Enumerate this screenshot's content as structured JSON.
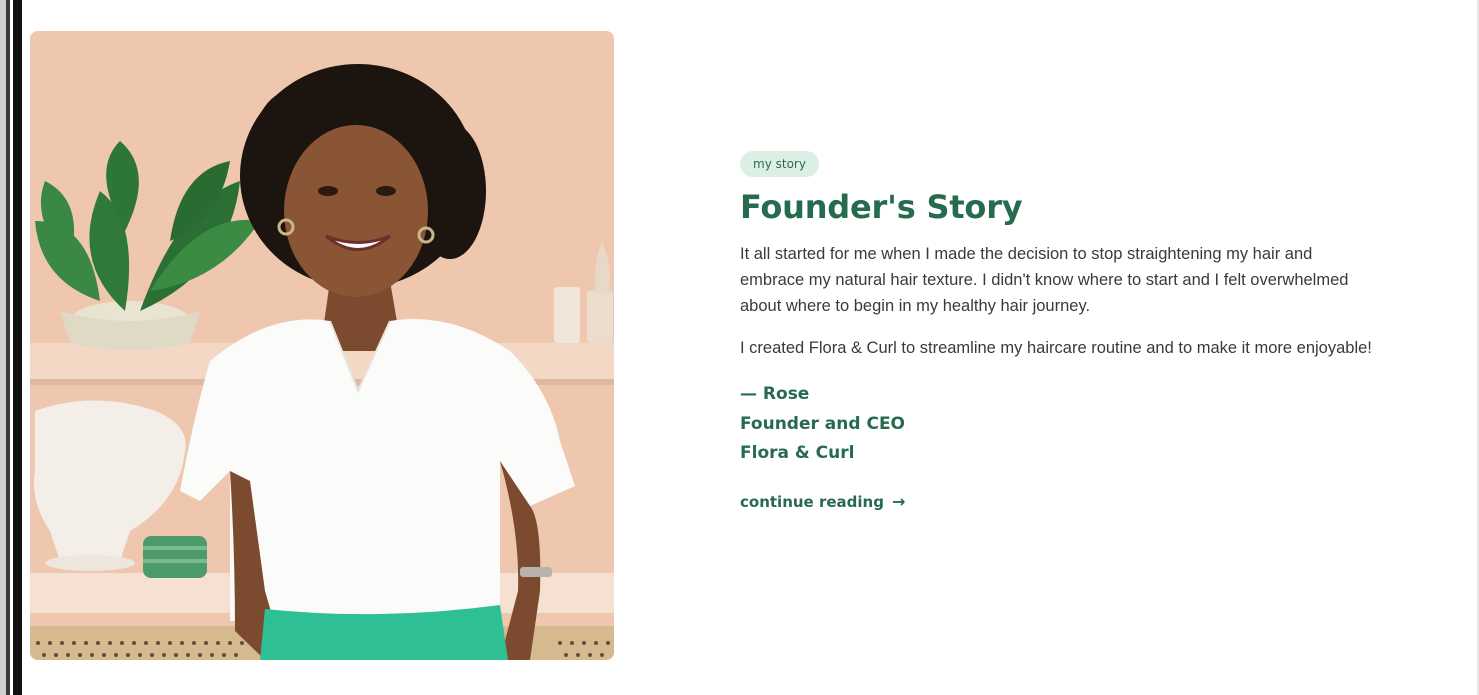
{
  "story": {
    "tag": "my story",
    "title": "Founder's Story",
    "paragraphs": [
      "It all started for me when I made the decision to stop straightening my hair and embrace my natural hair texture. I didn't know where to start and I felt overwhelmed about where to begin in my healthy hair journey.",
      "I created Flora & Curl to streamline my haircare routine and to make it more enjoyable!"
    ],
    "signature": {
      "name": "— Rose",
      "role": "Founder and CEO",
      "company": "Flora & Curl"
    },
    "continue_label": "continue reading",
    "continue_icon": "arrow-right-icon"
  },
  "colors": {
    "accent": "#276b4f",
    "tag_bg": "#dcefe4",
    "body_text": "#3a3a3a",
    "photo_bg": "#efc7af"
  }
}
